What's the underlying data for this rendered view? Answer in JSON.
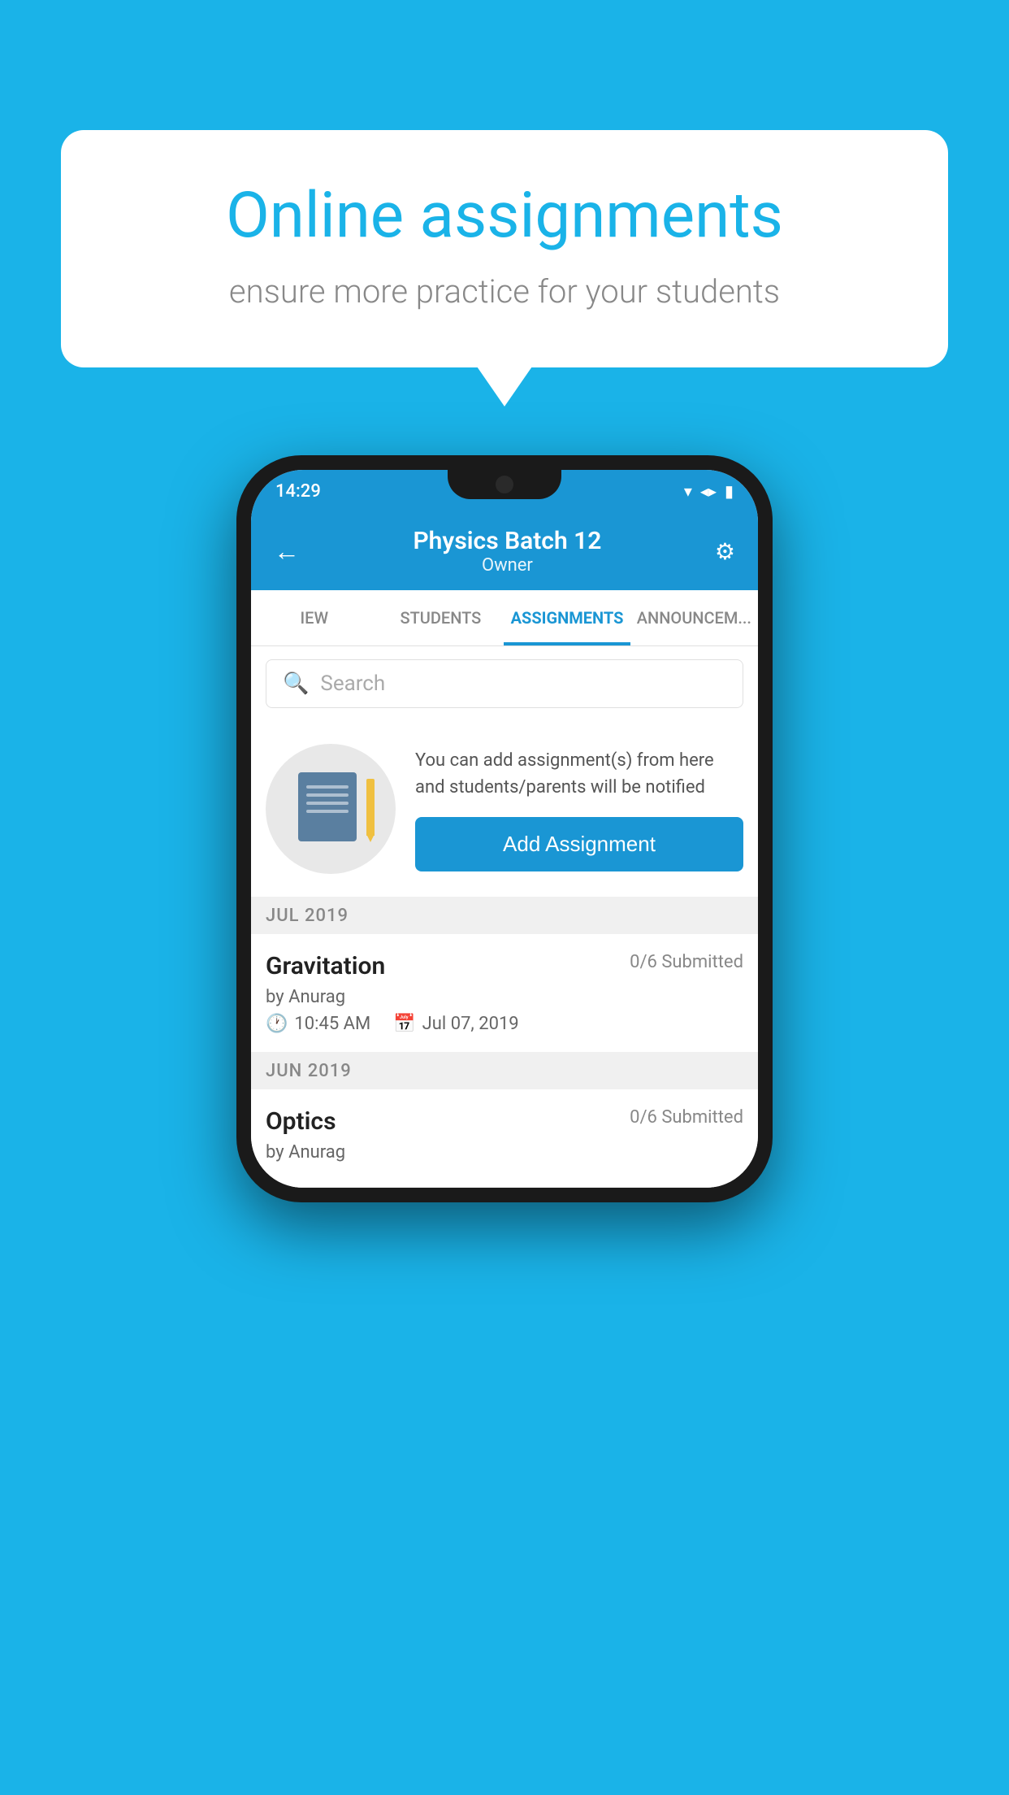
{
  "background_color": "#1ab3e8",
  "speech_bubble": {
    "title": "Online assignments",
    "subtitle": "ensure more practice for your students"
  },
  "phone": {
    "status_bar": {
      "time": "14:29",
      "icons": "▼◀▮"
    },
    "header": {
      "title": "Physics Batch 12",
      "subtitle": "Owner",
      "back_label": "←",
      "settings_label": "⚙"
    },
    "tabs": [
      {
        "label": "IEW",
        "active": false
      },
      {
        "label": "STUDENTS",
        "active": false
      },
      {
        "label": "ASSIGNMENTS",
        "active": true
      },
      {
        "label": "ANNOUNCEM...",
        "active": false
      }
    ],
    "search": {
      "placeholder": "Search"
    },
    "info_section": {
      "description": "You can add assignment(s) from here and students/parents will be notified",
      "button_label": "Add Assignment"
    },
    "assignment_groups": [
      {
        "month_label": "JUL 2019",
        "assignments": [
          {
            "name": "Gravitation",
            "submitted": "0/6 Submitted",
            "author": "by Anurag",
            "time": "10:45 AM",
            "date": "Jul 07, 2019"
          }
        ]
      },
      {
        "month_label": "JUN 2019",
        "assignments": [
          {
            "name": "Optics",
            "submitted": "0/6 Submitted",
            "author": "by Anurag",
            "time": "",
            "date": ""
          }
        ]
      }
    ]
  }
}
